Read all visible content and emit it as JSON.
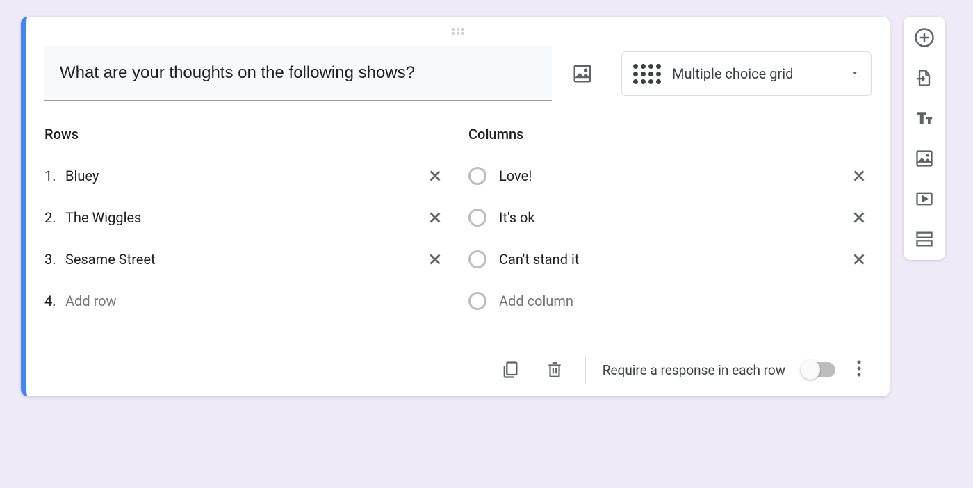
{
  "question": {
    "text": "What are your thoughts on the following shows?",
    "type_label": "Multiple choice grid"
  },
  "rows": {
    "heading": "Rows",
    "items": [
      {
        "num": "1.",
        "label": "Bluey"
      },
      {
        "num": "2.",
        "label": "The Wiggles"
      },
      {
        "num": "3.",
        "label": "Sesame Street"
      }
    ],
    "add_num": "4.",
    "add_placeholder": "Add row"
  },
  "columns": {
    "heading": "Columns",
    "items": [
      {
        "label": "Love!"
      },
      {
        "label": "It's ok"
      },
      {
        "label": "Can't stand it"
      }
    ],
    "add_placeholder": "Add column"
  },
  "footer": {
    "require_label": "Require a response in each row",
    "required_on": false
  },
  "side_toolbar": {
    "add_question": "Add question",
    "import": "Import questions",
    "title": "Add title and description",
    "image": "Add image",
    "video": "Add video",
    "section": "Add section"
  }
}
